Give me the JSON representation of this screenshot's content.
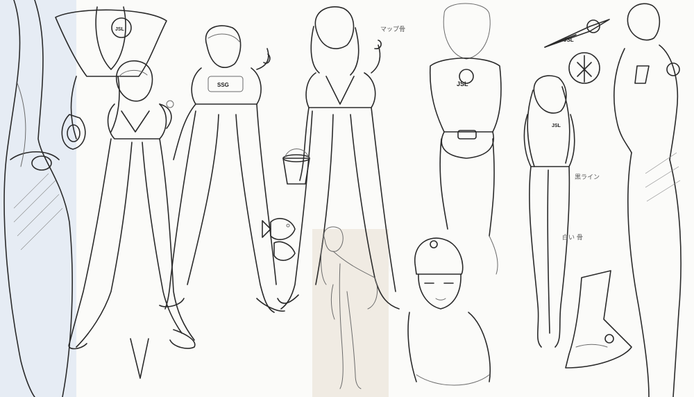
{
  "sheet": {
    "background": "#fbfbf9",
    "ink_color": "#2a2a2a",
    "paper_tint": "#e6ecf4",
    "inset_paper": "#f0ebe3"
  },
  "logos": {
    "chest_badge": "JSL",
    "hip_badge": "JSL",
    "emblem": "JSL",
    "chest_ssg": "SSG",
    "back_emblem": "JSL"
  },
  "notes": {
    "note_1": "マップ骨",
    "note_2": "白い 骨",
    "note_3": "黒ライン"
  },
  "icons": [
    "figure-sketch",
    "fish-sketch",
    "bucket-sketch",
    "helmet-sketch",
    "boot-sketch",
    "emblem-sketch"
  ]
}
